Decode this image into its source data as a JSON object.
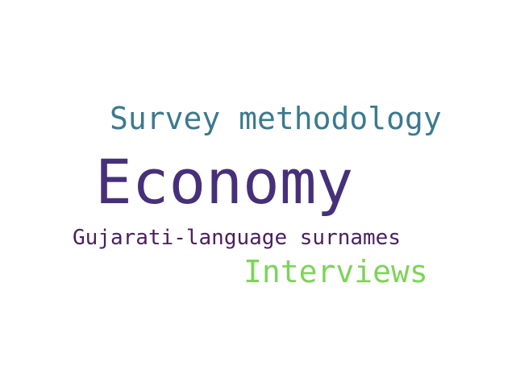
{
  "word_cloud": {
    "background_color": "#ffffff",
    "words": [
      {
        "text": "Survey methodology",
        "color": "#3b7a8f"
      },
      {
        "text": "Economy",
        "color": "#46307a"
      },
      {
        "text": "Gujarati-language surnames",
        "color": "#4a1f5e"
      },
      {
        "text": "Interviews",
        "color": "#7ed35a"
      }
    ]
  }
}
